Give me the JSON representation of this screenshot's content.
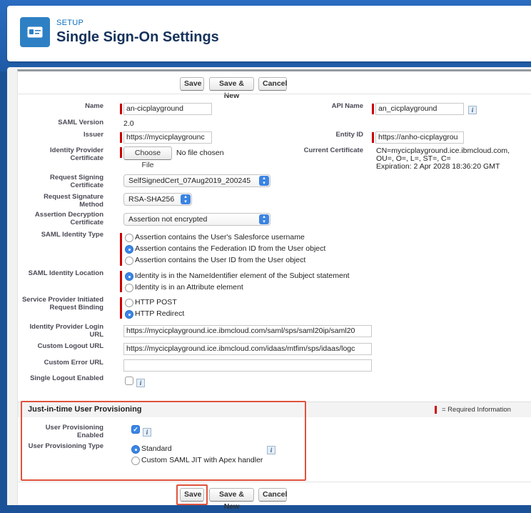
{
  "header": {
    "eyebrow": "SETUP",
    "title": "Single Sign-On Settings"
  },
  "buttons": {
    "save": "Save",
    "save_new": "Save & New",
    "cancel": "Cancel"
  },
  "form": {
    "name": {
      "label": "Name",
      "value": "an-cicplayground"
    },
    "api_name": {
      "label": "API Name",
      "value": "an_cicplayground"
    },
    "saml_version": {
      "label": "SAML Version",
      "value": "2.0"
    },
    "issuer": {
      "label": "Issuer",
      "value": "https://mycicplaygrounc"
    },
    "entity_id": {
      "label": "Entity ID",
      "value": "https://anho-cicplaygrou"
    },
    "idp_certificate": {
      "label": "Identity Provider Certificate",
      "button": "Choose File",
      "status": "No file chosen"
    },
    "current_certificate": {
      "label": "Current Certificate",
      "lines": [
        "CN=mycicplayground.ice.ibmcloud.com,",
        "OU=, O=, L=, ST=, C=",
        "Expiration: 2 Apr 2028 18:36:20 GMT"
      ]
    },
    "request_signing_certificate": {
      "label": "Request Signing Certificate",
      "selected": "SelfSignedCert_07Aug2019_200245"
    },
    "request_signature_method": {
      "label": "Request Signature Method",
      "selected": "RSA-SHA256"
    },
    "assertion_decryption_certificate": {
      "label": "Assertion Decryption Certificate",
      "selected": "Assertion not encrypted"
    },
    "saml_identity_type": {
      "label": "SAML Identity Type",
      "options": [
        "Assertion contains the User's Salesforce username",
        "Assertion contains the Federation ID from the User object",
        "Assertion contains the User ID from the User object"
      ],
      "selected_index": 1
    },
    "saml_identity_location": {
      "label": "SAML Identity Location",
      "options": [
        "Identity is in the NameIdentifier element of the Subject statement",
        "Identity is in an Attribute element"
      ],
      "selected_index": 0
    },
    "sp_initiated_binding": {
      "label": "Service Provider Initiated Request Binding",
      "options": [
        "HTTP POST",
        "HTTP Redirect"
      ],
      "selected_index": 1
    },
    "idp_login_url": {
      "label": "Identity Provider Login URL",
      "value": "https://mycicplayground.ice.ibmcloud.com/saml/sps/saml20ip/saml20"
    },
    "custom_logout_url": {
      "label": "Custom Logout URL",
      "value": "https://mycicplayground.ice.ibmcloud.com/idaas/mtfim/sps/idaas/logc"
    },
    "custom_error_url": {
      "label": "Custom Error URL",
      "value": ""
    },
    "single_logout": {
      "label": "Single Logout Enabled",
      "checked": false
    }
  },
  "jit": {
    "section_title": "Just-in-time User Provisioning",
    "required_legend": "= Required Information",
    "user_provisioning_enabled": {
      "label": "User Provisioning Enabled",
      "checked": true
    },
    "user_provisioning_type": {
      "label": "User Provisioning Type",
      "options": [
        "Standard",
        "Custom SAML JIT with Apex handler"
      ],
      "selected_index": 0
    }
  },
  "colors": {
    "accent": "#3a86e8",
    "required": "#cc0000",
    "highlight": "#e0523c",
    "header_icon": "#2e80c4"
  }
}
